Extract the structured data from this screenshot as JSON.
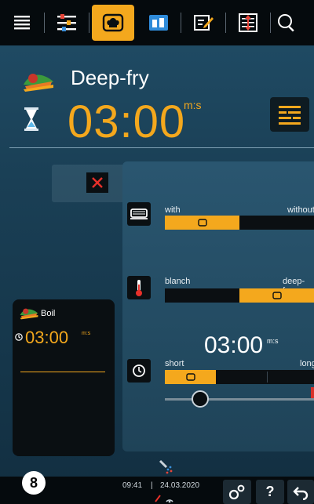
{
  "topbar": {
    "items": [
      {
        "icon": "menu-icon"
      },
      {
        "icon": "settings-sliders-icon"
      },
      {
        "icon": "chef-hat-icon",
        "active": true
      },
      {
        "icon": "cooking-paths-icon"
      },
      {
        "icon": "notes-edit-icon"
      },
      {
        "icon": "load-rack-icon"
      },
      {
        "icon": "search-icon"
      }
    ]
  },
  "header": {
    "title": "Deep-fry",
    "time": "03:00",
    "time_unit": "m:s"
  },
  "rows": {
    "fat": {
      "left": "with",
      "right": "without",
      "level": 0.5
    },
    "temperature": {
      "left": "blanch",
      "right": "deep-fry",
      "level": 0.5
    },
    "cook_time": {
      "value": "03:00",
      "unit": "m:s",
      "left": "short",
      "right": "long",
      "level": 0.34
    }
  },
  "side_card": {
    "title": "Boil",
    "time": "03:00",
    "unit": "m:s"
  },
  "bottombar": {
    "step": "8",
    "clock": "09:41",
    "date": "24.03.2020"
  },
  "colors": {
    "accent": "#f4a81d",
    "panel": "#1f4a63",
    "dark": "#0a0f12"
  }
}
